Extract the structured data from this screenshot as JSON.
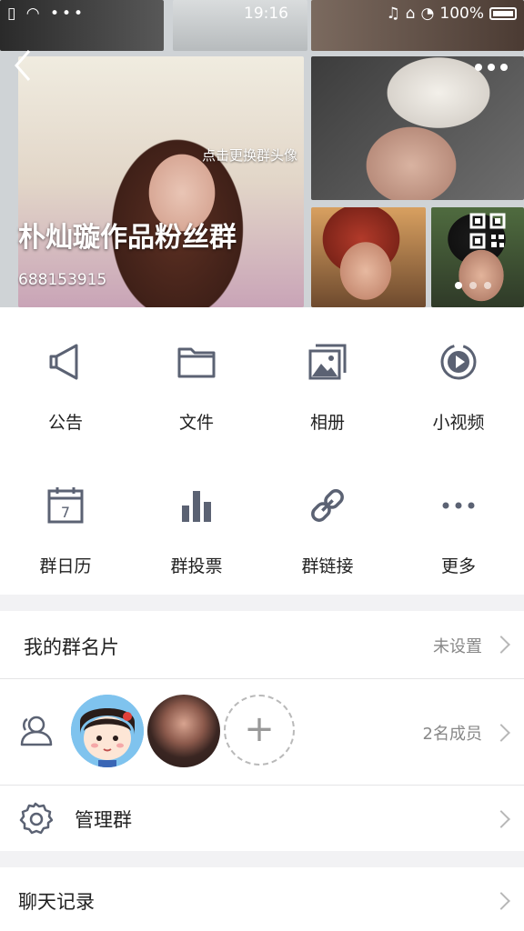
{
  "status_bar": {
    "left_icons": "▯ ◠ •••",
    "time": "19:16",
    "battery": "100%"
  },
  "header": {
    "change_avatar_hint": "点击更换群头像",
    "group_name": "朴灿璇作品粉丝群",
    "group_id": "688153915",
    "page_indicator": {
      "count": 3,
      "active": 0
    },
    "icons": [
      "back-arrow-icon",
      "more-dots-icon",
      "qr-code-icon"
    ]
  },
  "features": [
    {
      "label": "公告",
      "icon": "megaphone-icon"
    },
    {
      "label": "文件",
      "icon": "folder-icon"
    },
    {
      "label": "相册",
      "icon": "album-icon"
    },
    {
      "label": "小视频",
      "icon": "video-icon"
    },
    {
      "label": "群日历",
      "icon": "calendar-icon",
      "calendar_day": "7"
    },
    {
      "label": "群投票",
      "icon": "bar-chart-icon"
    },
    {
      "label": "群链接",
      "icon": "link-icon"
    },
    {
      "label": "更多",
      "icon": "more-dots-icon"
    }
  ],
  "my_card": {
    "label": "我的群名片",
    "value": "未设置"
  },
  "members": {
    "count_text": "2名成员",
    "add_symbol": "+"
  },
  "manage": {
    "label": "管理群"
  },
  "chat_history": {
    "label": "聊天记录"
  },
  "colors": {
    "icon_gray": "#5b6273",
    "chevron": "#b8b8b8",
    "bg": "#f2f2f4"
  }
}
